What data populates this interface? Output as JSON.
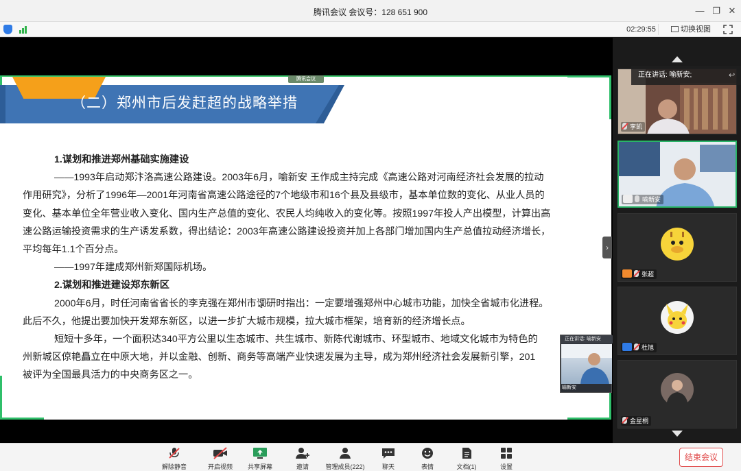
{
  "window": {
    "title": "腾讯会议 会议号：128 651 900"
  },
  "infobar": {
    "time": "02:29:55",
    "switch_view": "切换视图"
  },
  "slide": {
    "watermark": "腾讯会议",
    "title": "（二）郑州市后发赶超的战略举措",
    "h1": "1.谋划和推进郑州基础实施建设",
    "p1a": "——1993年启动郑汴洛高速公路建设。2003年6月，喻新安  王作成主持完成《高速公路对河南经济社会发展的拉动",
    "p1b": "作用研究》，分析了1996年—2001年河南省高速公路途径的7个地级市和16个县及县级市，基本单位数的变化、从业人员的",
    "p1c": "变化、基本单位全年营业收入变化、国内生产总值的变化、农民人均纯收入的变化等。按照1997年投人产出模型，计算出高",
    "p1d": "速公路运输投资需求的生产诱发系数，得出结论：2003年高速公路建设投资并加上各部门增加国内生产总值拉动经济增长，",
    "p1e": "平均每年1.1个百分点。",
    "p2": "——1997年建成郑州新郑国际机场。",
    "h2": "2.谋划和推进建设郑东新区",
    "p3a": "2000年6月，时任河南省省长的李克强在郑州市调研时指出：一定要增强郑州中心城市功能，加快全省城市化进程。",
    "p3b": "此后不久，他提出要加快开发郑东新区，以进一步扩大城市规模，拉大城市框架，培育新的经济增长点。",
    "p4a": "短短十多年，一个面积达340平方公里以生态城市、共生城市、新陈代谢城市、环型城市、地域文化城市为特色的",
    "p4b": "州新城区倞艳矗立在中原大地，并以金融、创新、商务等高端产业快速发展为主导，成为郑州经济社会发展新引擎，201",
    "p4c": "被评为全国最具活力的中央商务区之一。"
  },
  "pip": {
    "caption": "正在讲话: 喻新安",
    "name": "喻新安"
  },
  "panel": {
    "speaking": "正在讲话: 喻新安;",
    "participants": [
      {
        "name": "李凯"
      },
      {
        "name": "喻新安"
      },
      {
        "name": "张超"
      },
      {
        "name": "杜旭"
      },
      {
        "name": "金星桐"
      }
    ]
  },
  "toolbar": {
    "mute": "解除静音",
    "video": "开启视频",
    "share": "共享屏幕",
    "invite": "邀请",
    "members": "管理成员(222)",
    "chat": "聊天",
    "emoji": "表情",
    "docs": "文档(1)",
    "settings": "设置",
    "end": "结束会议"
  },
  "colors": {
    "accent_green": "#29b467",
    "end_red": "#e04a4a",
    "banner_blue": "#3f74b4",
    "ribbon_orange": "#f5a01a"
  }
}
